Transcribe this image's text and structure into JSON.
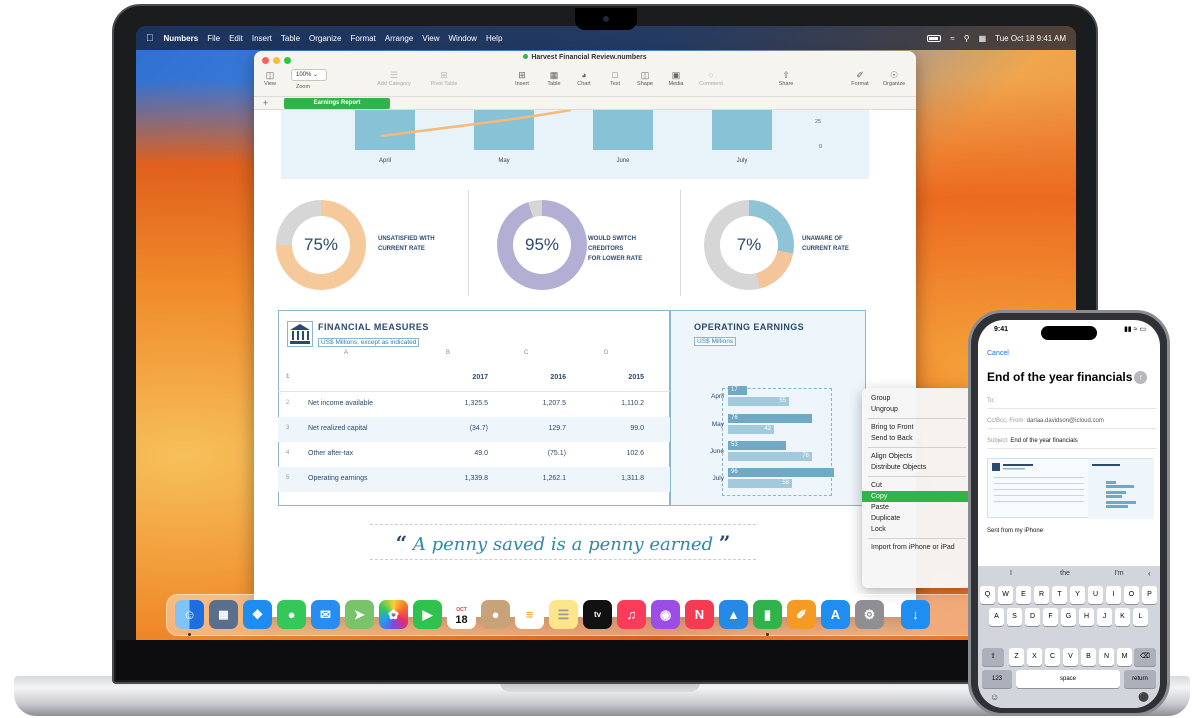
{
  "menubar": {
    "app_name": "Numbers",
    "items": [
      "File",
      "Edit",
      "Insert",
      "Table",
      "Organize",
      "Format",
      "Arrange",
      "View",
      "Window",
      "Help"
    ],
    "clock": "Tue Oct 18  9:41 AM"
  },
  "window": {
    "title": "Harvest Financial Review.numbers",
    "zoom_value": "100%",
    "toolbar": {
      "view": "View",
      "zoom": "Zoom",
      "add_category": "Add Category",
      "pivot_table": "Pivot Table",
      "insert": "Insert",
      "table": "Table",
      "chart": "Chart",
      "text": "Text",
      "shape": "Shape",
      "media": "Media",
      "comment": "Comment",
      "share": "Share",
      "format": "Format",
      "organize": "Organize"
    },
    "sheet_tab": "Earnings Report"
  },
  "top_chart": {
    "months": [
      "April",
      "May",
      "June",
      "July"
    ],
    "axis": [
      "25",
      "0"
    ]
  },
  "donuts": [
    {
      "value": "75%",
      "line1": "UNSATISFIED WITH",
      "line2": "CURRENT RATE",
      "line3": ""
    },
    {
      "value": "95%",
      "line1": "WOULD SWITCH",
      "line2": "CREDITORS",
      "line3": "FOR LOWER RATE"
    },
    {
      "value": "7%",
      "line1": "UNAWARE OF",
      "line2": "CURRENT RATE",
      "line3": ""
    }
  ],
  "financial_measures": {
    "title": "FINANCIAL MEASURES",
    "subtitle": "US$ Millions, except as indicated",
    "col_letters": [
      "A",
      "B",
      "C",
      "D"
    ],
    "years": [
      "2017",
      "2016",
      "2015"
    ],
    "rows": [
      {
        "num": "2",
        "label": "Net income available",
        "values": [
          "1,325.5",
          "1,207.5",
          "1,110.2"
        ]
      },
      {
        "num": "3",
        "label": "Net realized capital",
        "values": [
          "(34.7)",
          "129.7",
          "99.0"
        ]
      },
      {
        "num": "4",
        "label": "Other after-tax",
        "values": [
          "49.0",
          "(75.1)",
          "102.6"
        ]
      },
      {
        "num": "5",
        "label": "Operating earnings",
        "values": [
          "1,339.8",
          "1,262.1",
          "1,311.8"
        ]
      }
    ],
    "header_num": "1"
  },
  "operating_earnings": {
    "title": "OPERATING EARNINGS",
    "subtitle": "US$ Millions",
    "months": [
      "April",
      "May",
      "June",
      "July"
    ]
  },
  "chart_data": {
    "type": "bar",
    "categories": [
      "April",
      "May",
      "June",
      "July"
    ],
    "series": [
      {
        "values": [
          17,
          76,
          53,
          96
        ]
      },
      {
        "values": [
          55,
          42,
          76,
          58
        ]
      }
    ],
    "title": "OPERATING EARNINGS",
    "subtitle": "US$ Millions",
    "orientation": "horizontal"
  },
  "quote": {
    "open": "“",
    "text": "A penny saved is a penny earned",
    "close": "”"
  },
  "context_menu": {
    "groups": [
      [
        "Group",
        "Ungroup"
      ],
      [
        "Bring to Front",
        "Send to Back"
      ],
      [
        "Align Objects",
        "Distribute Objects"
      ],
      [
        "Cut",
        "Copy",
        "Paste",
        "Duplicate",
        "Lock"
      ],
      [
        "Import from iPhone or iPad"
      ]
    ],
    "highlighted": "Copy"
  },
  "dock": {
    "calendar_month": "OCT",
    "calendar_day": "18"
  },
  "iphone": {
    "time": "9:41",
    "cancel": "Cancel",
    "subject_title": "End of the year financials",
    "to_label": "To:",
    "cc_label": "Cc/Bcc, From:",
    "cc_value": "darlaa.davidson@icloud.com",
    "subject_label": "Subject:",
    "subject_value": "End of the year financials",
    "body": "Sent from my iPhone",
    "suggestions": [
      "I",
      "the",
      "I'm"
    ],
    "keys_row1": [
      "Q",
      "W",
      "E",
      "R",
      "T",
      "Y",
      "U",
      "I",
      "O",
      "P"
    ],
    "keys_row2": [
      "A",
      "S",
      "D",
      "F",
      "G",
      "H",
      "J",
      "K",
      "L"
    ],
    "keys_row3": [
      "Z",
      "X",
      "C",
      "V",
      "B",
      "N",
      "M"
    ],
    "key_123": "123",
    "key_space": "space",
    "key_return": "return"
  }
}
